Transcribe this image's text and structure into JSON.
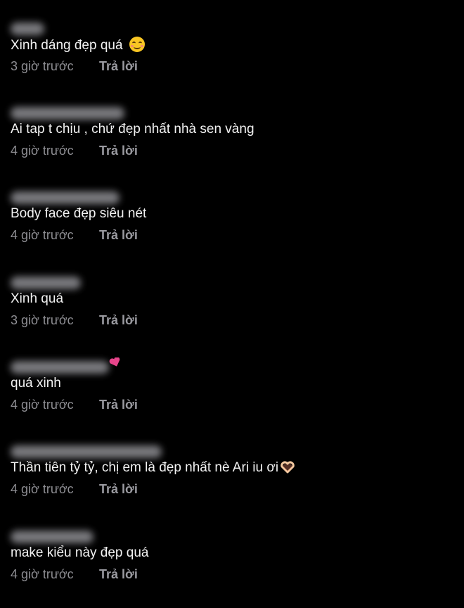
{
  "comments": [
    {
      "text": "Xinh dáng đẹp quá",
      "emoji": "smiling-face-icon",
      "time": "3 giờ trước",
      "reply_label": "Trả lời"
    },
    {
      "text": "Ai tap t chịu , chứ đẹp nhất nhà sen vàng",
      "time": "4 giờ trước",
      "reply_label": "Trả lời"
    },
    {
      "text": "Body face đẹp siêu nét",
      "time": "4 giờ trước",
      "reply_label": "Trả lời"
    },
    {
      "text": "Xinh quá",
      "time": "3 giờ trước",
      "reply_label": "Trả lời"
    },
    {
      "text": "quá xinh",
      "time": "4 giờ trước",
      "reply_label": "Trả lời"
    },
    {
      "text": "Thần tiên tỷ tỷ, chị em là đẹp nhất nè Ari iu ơi",
      "emoji": "heart-hands-icon",
      "time": "4 giờ trước",
      "reply_label": "Trả lời"
    },
    {
      "text": "make kiểu này đẹp quá",
      "time": "4 giờ trước",
      "reply_label": "Trả lời"
    }
  ],
  "colors": {
    "background": "#000000",
    "text": "#f2f2f2",
    "meta": "#8e8e93",
    "heart_pink": "#e8458b"
  }
}
